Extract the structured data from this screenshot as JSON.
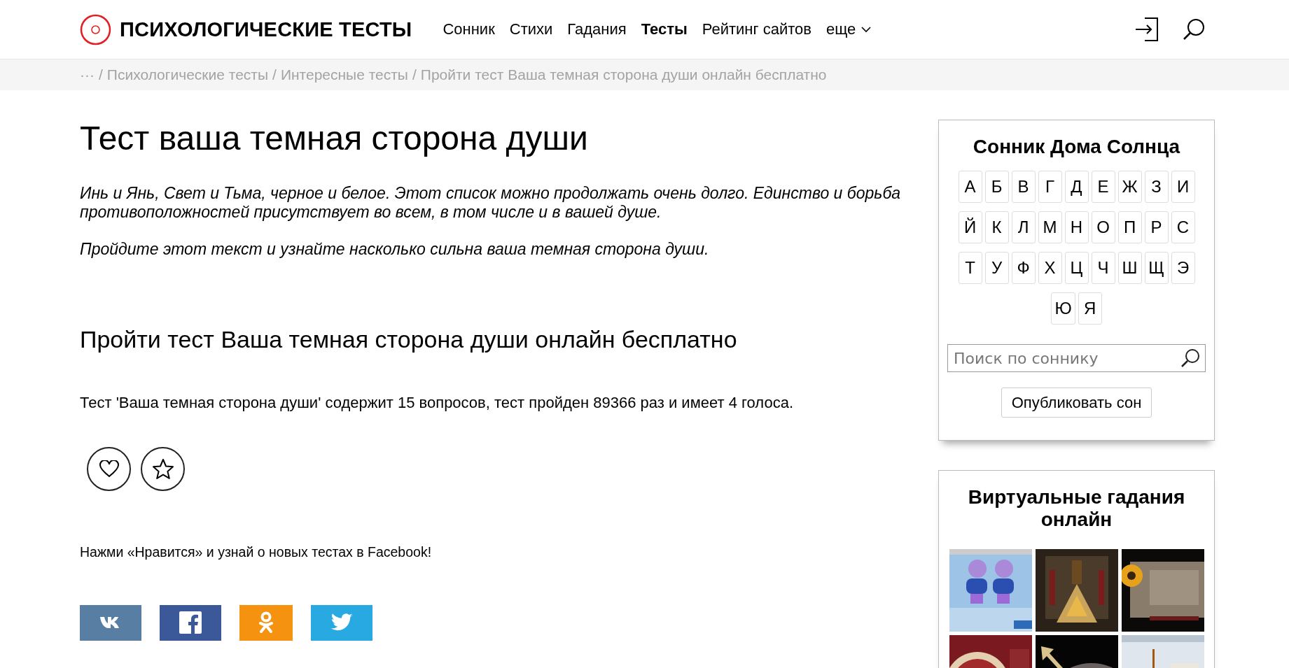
{
  "header": {
    "logo_title": "ПСИХОЛОГИЧЕСКИЕ ТЕСТЫ",
    "nav": [
      {
        "label": "Сонник",
        "selected": false
      },
      {
        "label": "Стихи",
        "selected": false
      },
      {
        "label": "Гадания",
        "selected": false
      },
      {
        "label": "Тесты",
        "selected": true
      },
      {
        "label": "Рейтинг сайтов",
        "selected": false
      }
    ],
    "more": "еще"
  },
  "breadcrumbs": [
    {
      "label": "···"
    },
    {
      "separator": "/",
      "label": "Психологические тесты"
    },
    {
      "separator": "/",
      "label": "Интересные тесты"
    },
    {
      "separator": "/",
      "label": "Пройти тест Ваша темная сторона души онлайн бесплатно"
    }
  ],
  "main": {
    "title": "Тест ваша темная сторона души",
    "intro": [
      "Инь и Янь, Свет и Тьма, черное и белое. Этот список можно продолжать очень долго. Единство и борьба противоположностей присутствует во всем, в том числе и в вашей душе.",
      "Пройдите этот текст и узнайте насколько сильна ваша темная сторона души."
    ],
    "subtitle": "Пройти тест Ваша темная сторона души онлайн бесплатно",
    "info": "Тест 'Ваша темная сторона души' содержит 15 вопросов, тест пройден 89366 раз и имеет 4 голоса.",
    "facebook_note": "Нажми «Нравится» и узнай о новых тестах в Facebook!",
    "share": [
      {
        "kind": "vk",
        "color": "#587ea3"
      },
      {
        "kind": "facebook",
        "color": "#3b5998"
      },
      {
        "kind": "ok",
        "color": "#f59310"
      },
      {
        "kind": "twitter",
        "color": "#29a9e1"
      }
    ]
  },
  "sidebar": {
    "dream_book": {
      "title": "Сонник Дома Солнца",
      "alphabet_rows": [
        [
          "А",
          "Б",
          "В",
          "Г",
          "Д",
          "Е",
          "Ж",
          "З",
          "И"
        ],
        [
          "Й",
          "К",
          "Л",
          "М",
          "Н",
          "О",
          "П",
          "Р",
          "С"
        ],
        [
          "Т",
          "У",
          "Ф",
          "Х",
          "Ц",
          "Ч",
          "Ш",
          "Щ",
          "Э"
        ],
        [
          "Ю",
          "Я"
        ]
      ],
      "search": {
        "placeholder": "Поиск по соннику"
      },
      "button": "Опубликовать сон"
    },
    "fortunes": {
      "title": "Виртуальные гадания онлайн"
    }
  }
}
